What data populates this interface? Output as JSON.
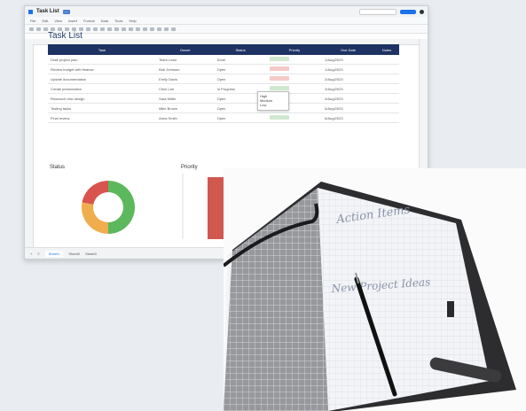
{
  "doc": {
    "title": "Task List",
    "badge": "···"
  },
  "menu": [
    "File",
    "Edit",
    "View",
    "Insert",
    "Format",
    "Data",
    "Tools",
    "Help"
  ],
  "sheet": {
    "title": "Task List",
    "columns": [
      "Task",
      "Owner",
      "Status",
      "Priority",
      "Due Date",
      "Notes"
    ],
    "rows": [
      {
        "task": "Draft project plan",
        "owner": "Team Lead",
        "status": "Done",
        "priority": "green",
        "due": "1/Aug/2023"
      },
      {
        "task": "Review budget with finance",
        "owner": "Bob Johnson",
        "status": "Open",
        "priority": "red",
        "due": "1/Aug/2023"
      },
      {
        "task": "Update documentation",
        "owner": "Emily Davis",
        "status": "Open",
        "priority": "red",
        "due": "2/Aug/2023"
      },
      {
        "task": "Create presentation",
        "owner": "Chris Lee",
        "status": "In Progress",
        "priority": "green",
        "due": "3/Aug/2023"
      },
      {
        "task": "Research new design",
        "owner": "Sara Miller",
        "status": "Open",
        "priority": "green",
        "due": "4/Aug/2023"
      },
      {
        "task": "Testing tasks",
        "owner": "Mike Brown",
        "status": "Open",
        "priority": "red",
        "due": "5/Aug/2023"
      },
      {
        "task": "Final review",
        "owner": "Anna Smith",
        "status": "Open",
        "priority": "green",
        "due": "6/Aug/2023"
      }
    ]
  },
  "popup": {
    "items": [
      "High",
      "Medium",
      "Low"
    ]
  },
  "charts": {
    "status_label": "Status",
    "priority_label": "Priority"
  },
  "status_chart": {
    "slices": [
      {
        "label": "Done",
        "value": 0.5,
        "color": "#5cb85c"
      },
      {
        "label": "In Progress",
        "value": 0.28,
        "color": "#f0ad4e"
      },
      {
        "label": "Open",
        "value": 0.22,
        "color": "#d9534f"
      }
    ]
  },
  "tabs": [
    "Sheet1",
    "Sheet2",
    "Sheet3"
  ],
  "notebook": {
    "line1": "Action Items",
    "line2": "New Project Ideas"
  },
  "colors": {
    "accent": "#1e3263",
    "green": "#5cb85c",
    "red": "#d9534f",
    "orange": "#f0ad4e"
  }
}
